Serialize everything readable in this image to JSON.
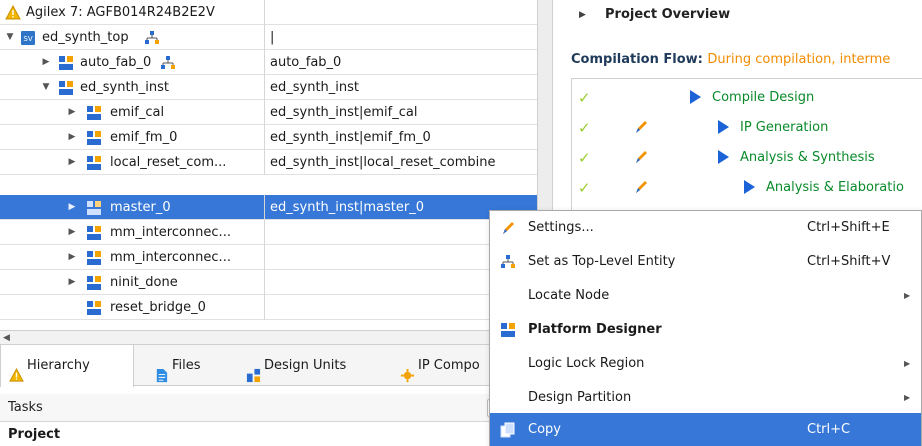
{
  "hierarchy": {
    "device_label": "Agilex 7: AGFB014R24B2E2V",
    "rows": [
      {
        "name": "ed_synth_top",
        "path": "|"
      },
      {
        "name": "auto_fab_0",
        "path": "auto_fab_0"
      },
      {
        "name": "ed_synth_inst",
        "path": "ed_synth_inst"
      },
      {
        "name": "emif_cal",
        "path": "ed_synth_inst|emif_cal"
      },
      {
        "name": "emif_fm_0",
        "path": "ed_synth_inst|emif_fm_0"
      },
      {
        "name": "local_reset_com...",
        "path": "ed_synth_inst|local_reset_combine"
      },
      {
        "name": "master_0",
        "path": "ed_synth_inst|master_0"
      },
      {
        "name": "mm_interconnec...",
        "path": ""
      },
      {
        "name": "mm_interconnec...",
        "path": ""
      },
      {
        "name": "ninit_done",
        "path": ""
      },
      {
        "name": "reset_bridge_0",
        "path": ""
      }
    ]
  },
  "tabs": [
    {
      "label": "Hierarchy"
    },
    {
      "label": "Files"
    },
    {
      "label": "Design Units"
    },
    {
      "label": "IP Compo"
    }
  ],
  "tasks": {
    "label": "Tasks",
    "project_label": "Project"
  },
  "right_panel": {
    "project_overview": "Project Overview",
    "flow_title": "Compilation Flow:",
    "flow_note": "During compilation, interme",
    "flow_items": [
      {
        "label": "Compile Design"
      },
      {
        "label": "IP Generation"
      },
      {
        "label": "Analysis & Synthesis"
      },
      {
        "label": "Analysis & Elaboratio"
      }
    ]
  },
  "context_menu": {
    "items": [
      {
        "label": "Settings...",
        "shortcut": "Ctrl+Shift+E"
      },
      {
        "label": "Set as Top-Level Entity",
        "shortcut": "Ctrl+Shift+V"
      },
      {
        "label": "Locate Node",
        "shortcut": ""
      },
      {
        "label": "Platform Designer",
        "shortcut": ""
      },
      {
        "label": "Logic Lock Region",
        "shortcut": ""
      },
      {
        "label": "Design Partition",
        "shortcut": ""
      },
      {
        "label": "Copy",
        "shortcut": "Ctrl+C"
      }
    ]
  },
  "colors": {
    "selection": "#3677d7",
    "flow_text": "#0a8a2a",
    "note_text": "#f28c00",
    "play_arrow": "#1c63d8",
    "check": "#9acd32"
  }
}
